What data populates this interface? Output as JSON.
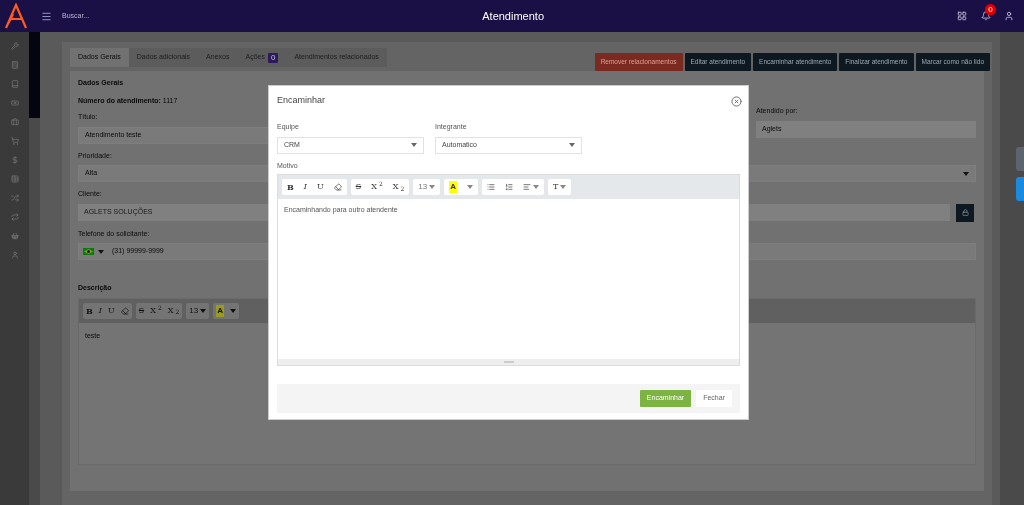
{
  "header": {
    "search_placeholder": "Buscar...",
    "title": "Atendimento",
    "notification_count": "0"
  },
  "tabs": [
    {
      "label": "Dados Gerais",
      "selected": true
    },
    {
      "label": "Dados adicionais",
      "selected": false
    },
    {
      "label": "Anexos",
      "selected": false
    },
    {
      "label": "Ações",
      "selected": false,
      "badge": "0"
    },
    {
      "label": "Atendimentos relacionados",
      "selected": false
    }
  ],
  "actions": [
    {
      "label": "Remover relacionamentos",
      "kind": "danger"
    },
    {
      "label": "Editar atendimento",
      "kind": "dark"
    },
    {
      "label": "Encaminhar atendimento",
      "kind": "dark"
    },
    {
      "label": "Finalizar atendimento",
      "kind": "dark"
    },
    {
      "label": "Marcar como não lido",
      "kind": "dark"
    }
  ],
  "details": {
    "section_title": "Dados Gerais",
    "number_label": "Número do atendimento:",
    "number": "1117",
    "title_field": {
      "label": "Título:",
      "value": "Atendimento teste"
    },
    "assignee": {
      "label": "Atendido por:",
      "value": "Aglets"
    },
    "fields": [
      {
        "label": "Prioridade:",
        "value": "Alta",
        "kind": "select"
      },
      {
        "label": "Cliente:",
        "value": "AGLETS SOLUÇÕES",
        "kind": "locked"
      },
      {
        "label": "Telefone do solicitante:",
        "value": "(31) 99999-9999",
        "kind": "phone"
      }
    ],
    "description": {
      "label": "Descrição",
      "text": "teste",
      "toolbar": [
        [
          {
            "kind": "bold",
            "label": "B"
          },
          {
            "kind": "italic",
            "label": "I"
          },
          {
            "kind": "underline",
            "label": "U"
          },
          {
            "kind": "eraser"
          }
        ],
        [
          {
            "kind": "strike",
            "label": "S"
          },
          {
            "kind": "script",
            "label": "X$^{2}$"
          },
          {
            "kind": "script",
            "label": "X$_{2}$"
          }
        ],
        [
          {
            "kind": "size",
            "label": "13"
          }
        ],
        [
          {
            "kind": "highlight",
            "label": "A"
          },
          {
            "kind": "caret"
          }
        ]
      ]
    }
  },
  "modal": {
    "title": "Encaminhar",
    "team": {
      "label": "Equipe",
      "value": "CRM"
    },
    "member": {
      "label": "Integrante",
      "value": "Automatico"
    },
    "reason": {
      "label": "Motivo",
      "text": "Encaminhando para outro atendente",
      "toolbar": [
        [
          {
            "kind": "bold",
            "label": "B"
          },
          {
            "kind": "italic",
            "label": "I"
          },
          {
            "kind": "underline",
            "label": "U"
          },
          {
            "kind": "eraser"
          }
        ],
        [
          {
            "kind": "strike",
            "label": "S"
          },
          {
            "kind": "script",
            "label": "X$^{2}$"
          },
          {
            "kind": "script",
            "label": "X$_{2}$"
          }
        ],
        [
          {
            "kind": "size",
            "label": "13"
          }
        ],
        [
          {
            "kind": "highlight",
            "label": "A"
          },
          {
            "kind": "caret"
          }
        ],
        [
          {
            "kind": "ul"
          },
          {
            "kind": "ol"
          },
          {
            "kind": "align"
          }
        ],
        [
          {
            "kind": "height",
            "label": "T"
          }
        ]
      ]
    },
    "buttons": [
      {
        "label": "Encaminhar",
        "kind": "primary"
      },
      {
        "label": "Fechar",
        "kind": "default"
      }
    ]
  }
}
